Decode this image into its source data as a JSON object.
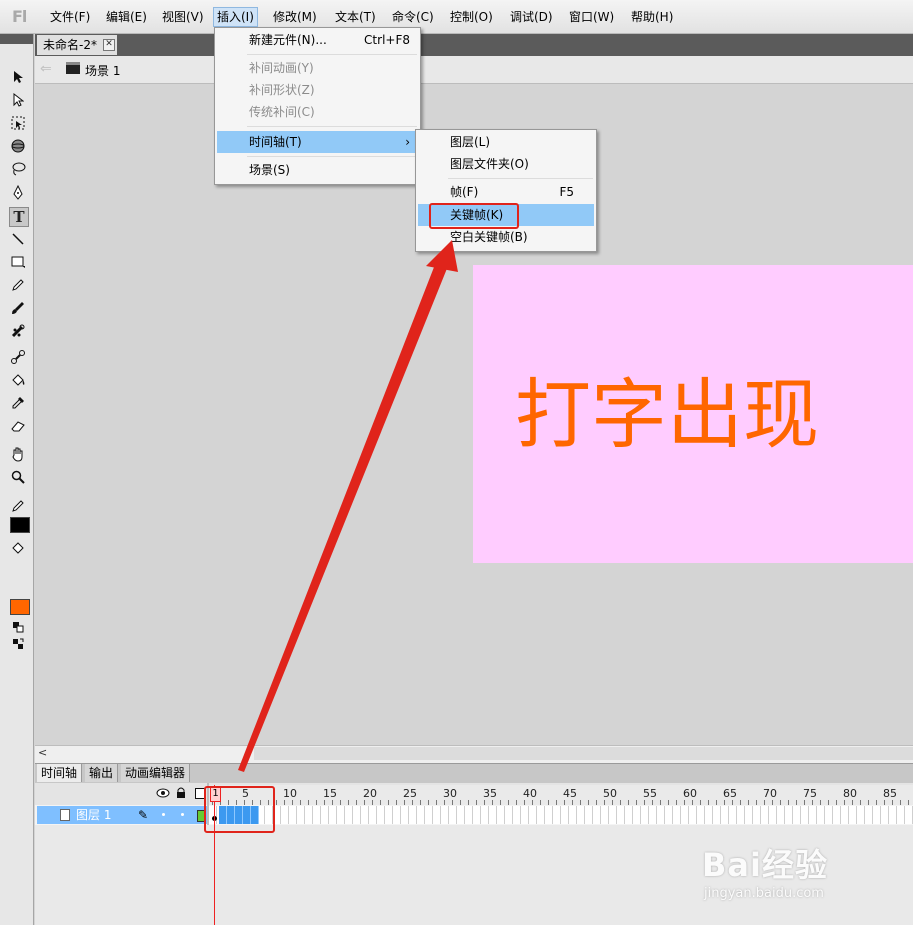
{
  "app": {
    "logo": "Fl"
  },
  "menubar": {
    "items": [
      "文件(F)",
      "编辑(E)",
      "视图(V)",
      "插入(I)",
      "修改(M)",
      "文本(T)",
      "命令(C)",
      "控制(O)",
      "调试(D)",
      "窗口(W)",
      "帮助(H)"
    ],
    "active_index": 3
  },
  "document": {
    "tab_label": "未命名-2*",
    "close_glyph": "✕"
  },
  "scene": {
    "label": "场景 1"
  },
  "stage": {
    "text": "打字出现",
    "background": "#ffccff",
    "text_color": "#ff6600"
  },
  "insert_menu": {
    "new_symbol": {
      "label": "新建元件(N)...",
      "shortcut": "Ctrl+F8"
    },
    "motion_tween": "补间动画(Y)",
    "shape_tween": "补间形状(Z)",
    "classic_tween": "传统补间(C)",
    "timeline": {
      "label": "时间轴(T)",
      "arrow": "›"
    },
    "scene": "场景(S)"
  },
  "timeline_submenu": {
    "layer": "图层(L)",
    "layer_folder": "图层文件夹(O)",
    "frame": {
      "label": "帧(F)",
      "shortcut": "F5"
    },
    "keyframe": "关键帧(K)",
    "blank_keyframe": "空白关键帧(B)"
  },
  "panel_tabs": [
    "时间轴",
    "输出",
    "动画编辑器"
  ],
  "timeline": {
    "current_frame": "1",
    "ruler_labels": [
      "5",
      "10",
      "15",
      "20",
      "25",
      "30",
      "35",
      "40",
      "45",
      "50",
      "55",
      "60",
      "65",
      "70",
      "75",
      "80",
      "85"
    ],
    "layer_name": "图层 1"
  },
  "colors": {
    "stroke": "#000000",
    "fill": "#ff6600",
    "accent": "#e0241b",
    "highlight": "#91c9f7"
  },
  "watermark": {
    "main": "Bai经验",
    "sub": "jingyan.baidu.com"
  }
}
